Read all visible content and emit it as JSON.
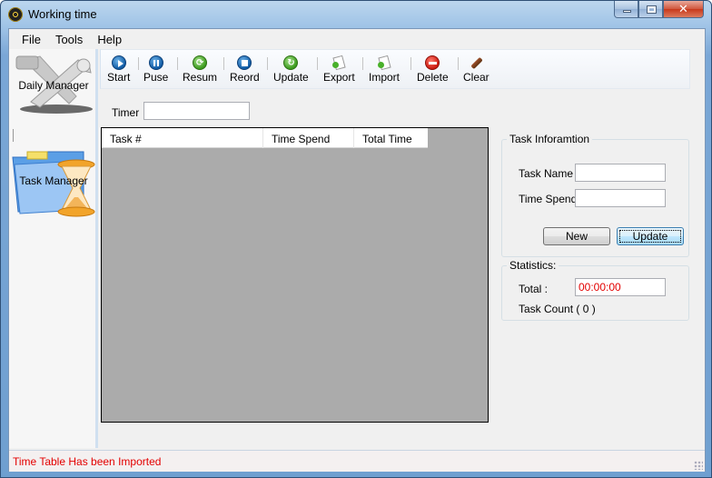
{
  "window": {
    "title": "Working time",
    "controls": [
      "minimize",
      "maximize",
      "close"
    ]
  },
  "menu": {
    "items": [
      {
        "label": "File"
      },
      {
        "label": "Tools"
      },
      {
        "label": "Help"
      }
    ]
  },
  "sidebar": {
    "items": [
      {
        "label": "Daily Manager",
        "icon": "wrench-hammer-icon"
      },
      {
        "label": "Task Manager",
        "icon": "folder-hourglass-icon"
      }
    ]
  },
  "toolbar": {
    "buttons": [
      {
        "label": "Start",
        "icon": "play-icon"
      },
      {
        "label": "Puse",
        "icon": "pause-icon"
      },
      {
        "label": "Resum",
        "icon": "resume-icon"
      },
      {
        "label": "Reord",
        "icon": "stop-icon"
      },
      {
        "label": "Update",
        "icon": "refresh-icon"
      },
      {
        "label": "Export",
        "icon": "export-icon"
      },
      {
        "label": "Import",
        "icon": "import-icon"
      },
      {
        "label": "Delete",
        "icon": "delete-icon"
      },
      {
        "label": "Clear",
        "icon": "broom-icon"
      }
    ]
  },
  "timer": {
    "label": "Timer",
    "value": ""
  },
  "grid": {
    "columns": [
      "Task #",
      "Time Spend",
      "Total Time"
    ],
    "rows": []
  },
  "task_info": {
    "title": "Task Inforamtion",
    "task_name_label": "Task Name",
    "task_name_value": "",
    "time_spend_label": "Time Spend",
    "time_spend_value": "",
    "new_button": "New",
    "update_button": "Update"
  },
  "statistics": {
    "title": "Statistics:",
    "total_label": "Total :",
    "total_value": "00:00:00",
    "task_count": "Task Count ( 0 )"
  },
  "status": {
    "message": "Time Table Has been Imported",
    "color": "#e30000"
  }
}
